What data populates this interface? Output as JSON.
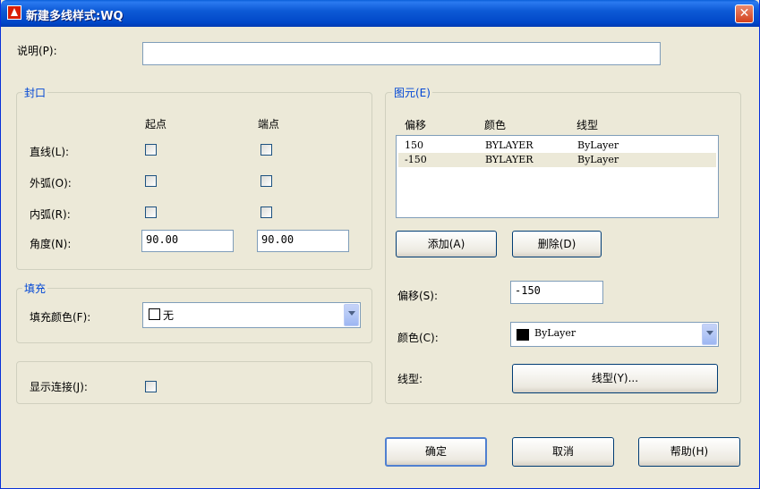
{
  "window": {
    "title": "新建多线样式:WQ",
    "close_icon": "close-icon"
  },
  "description": {
    "label": "说明(P):",
    "value": ""
  },
  "caps": {
    "group_title": "封口",
    "start_label": "起点",
    "end_label": "端点",
    "rows": [
      {
        "label": "直线(L):",
        "start_checked": false,
        "end_checked": false
      },
      {
        "label": "外弧(O):",
        "start_checked": false,
        "end_checked": false
      },
      {
        "label": "内弧(R):",
        "start_checked": false,
        "end_checked": false
      }
    ],
    "angle_label": "角度(N):",
    "angle_start": "90.00",
    "angle_end": "90.00"
  },
  "fill": {
    "group_title": "填充",
    "label": "填充颜色(F):",
    "value": "无"
  },
  "display_joints": {
    "label": "显示连接(J):",
    "checked": false
  },
  "elements": {
    "group_title": "图元(E)",
    "columns": [
      "偏移",
      "颜色",
      "线型"
    ],
    "rows": [
      {
        "offset": "150",
        "color": "BYLAYER",
        "linetype": "ByLayer",
        "selected": false
      },
      {
        "offset": "-150",
        "color": "BYLAYER",
        "linetype": "ByLayer",
        "selected": true
      }
    ],
    "add_label": "添加(A)",
    "delete_label": "删除(D)",
    "offset_label": "偏移(S):",
    "offset_value": "-150",
    "color_label": "颜色(C):",
    "color_value": "ByLayer",
    "color_swatch": "#000000",
    "linetype_label": "线型:",
    "linetype_button": "线型(Y)..."
  },
  "buttons": {
    "ok": "确定",
    "cancel": "取消",
    "help": "帮助(H)"
  }
}
